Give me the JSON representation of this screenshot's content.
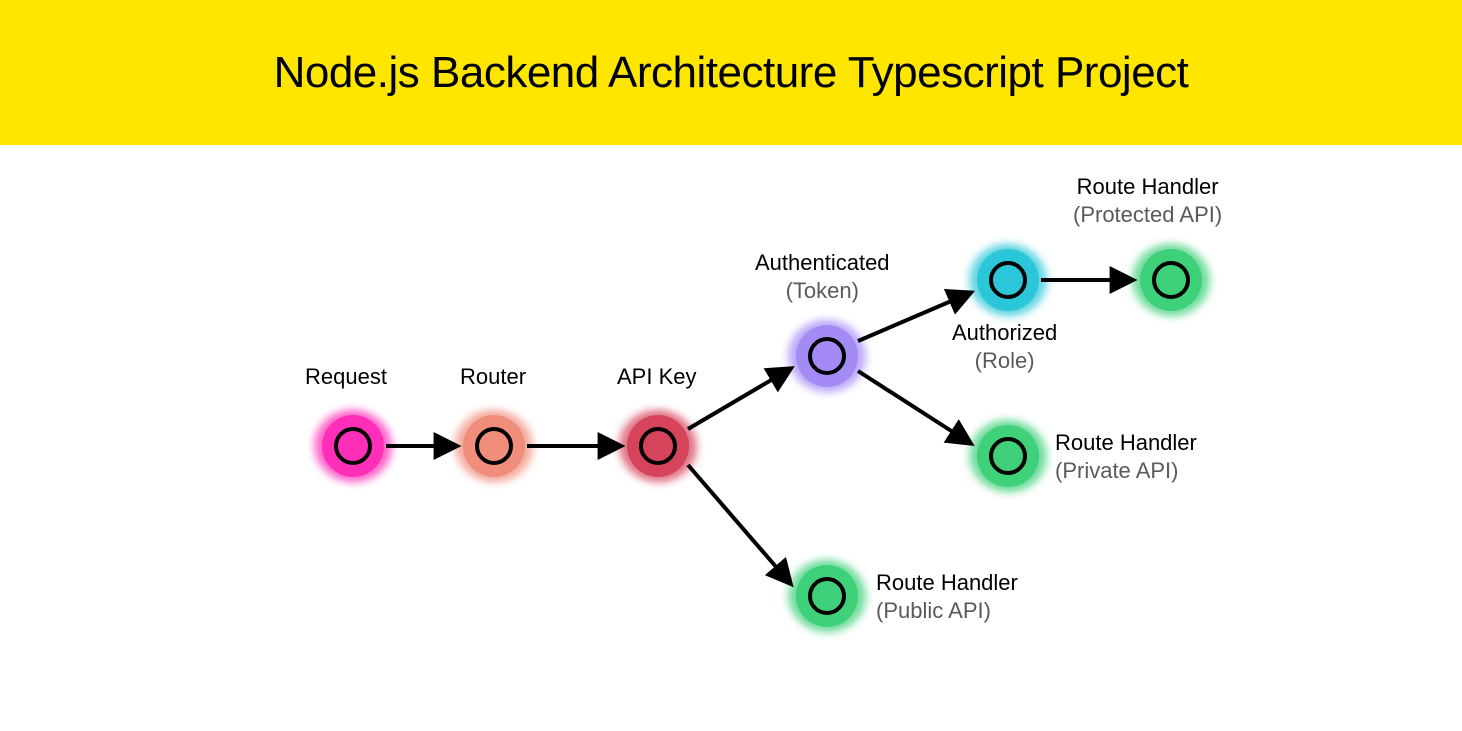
{
  "header": {
    "title": "Node.js Backend Architecture Typescript Project"
  },
  "nodes": {
    "request": {
      "label": "Request",
      "sublabel": "",
      "color": "#ff2fb9"
    },
    "router": {
      "label": "Router",
      "sublabel": "",
      "color": "#f08d7b"
    },
    "apikey": {
      "label": "API Key",
      "sublabel": "",
      "color": "#d6445c"
    },
    "authenticated": {
      "label": "Authenticated",
      "sublabel": "(Token)",
      "color": "#a58af6"
    },
    "authorized": {
      "label": "Authorized",
      "sublabel": "(Role)",
      "color": "#2bc7d9"
    },
    "protected": {
      "label": "Route Handler",
      "sublabel": "(Protected API)",
      "color": "#3fd07a"
    },
    "private": {
      "label": "Route Handler",
      "sublabel": "(Private API)",
      "color": "#3fd07a"
    },
    "public": {
      "label": "Route Handler",
      "sublabel": "(Public API)",
      "color": "#3fd07a"
    }
  },
  "arrows": [
    {
      "from": "request",
      "to": "router"
    },
    {
      "from": "router",
      "to": "apikey"
    },
    {
      "from": "apikey",
      "to": "authenticated"
    },
    {
      "from": "apikey",
      "to": "public"
    },
    {
      "from": "authenticated",
      "to": "authorized"
    },
    {
      "from": "authenticated",
      "to": "private"
    },
    {
      "from": "authorized",
      "to": "protected"
    }
  ]
}
